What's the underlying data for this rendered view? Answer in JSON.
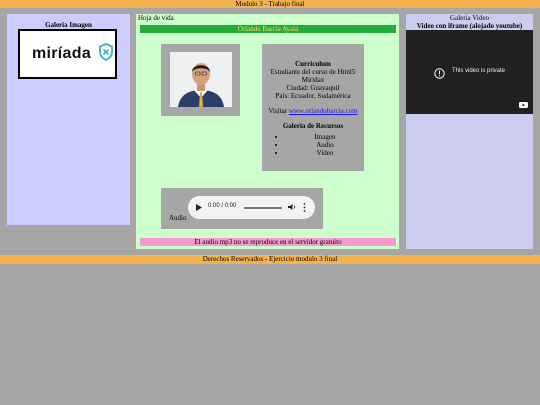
{
  "header": {
    "title": "Modulo 3 - Trabajo final"
  },
  "footer": {
    "text": "Derechos Reservados - Ejercicio modulo 3 final"
  },
  "gallery_image": {
    "title": "Galeria Imagen",
    "logo_text": "miríada",
    "logo_color": "#3ab0c3"
  },
  "main": {
    "label": "Hoja de vida",
    "name_bar": "Orlando Barcia Ayala",
    "name_bar_color": "#22aa3a",
    "cv": {
      "heading": "Curriculum",
      "line1": "Estudiante del curso de Html5",
      "line2": "Miridax",
      "line3": "Ciudad: Guayaquil",
      "line4": "País: Ecuador, Sudamérica",
      "visit_prefix": "Visitar ",
      "visit_link": "www.orlandobarcia.com",
      "resources_heading": "Galeria de Recursos",
      "resources": [
        "Imagen",
        "Audio",
        "Video"
      ]
    },
    "audio": {
      "label": "Audio",
      "time": "0:00 / 0:00"
    },
    "note": "El audio mp3 no se reproduce en el servidor gratuito",
    "note_color": "#f39ad0"
  },
  "gallery_video": {
    "title": "Galeria Video",
    "subtitle": "Video con iframe (alojado youtube)",
    "message": "This video is private"
  }
}
